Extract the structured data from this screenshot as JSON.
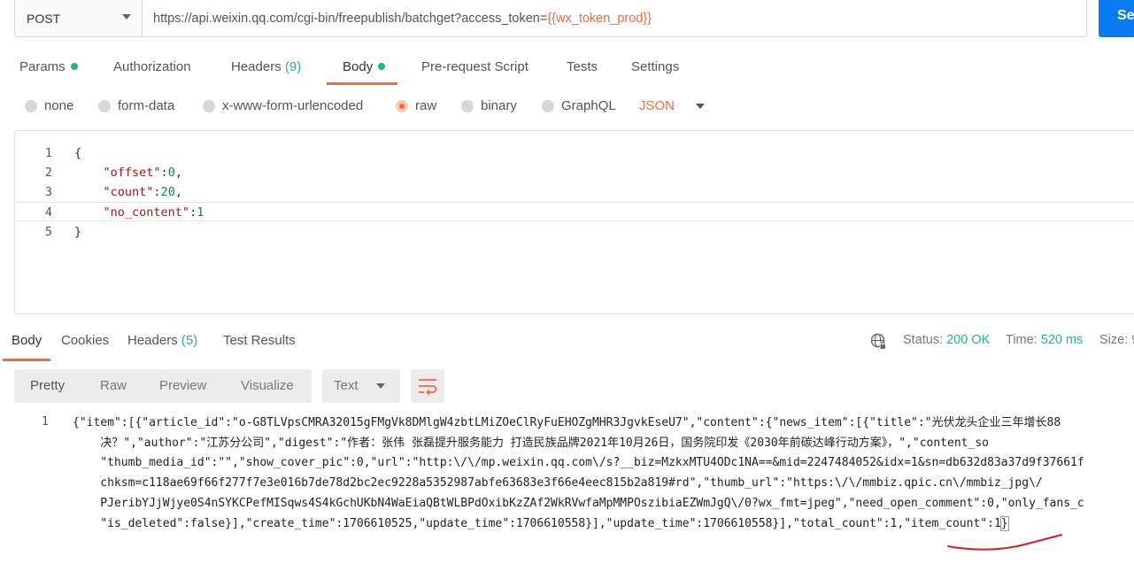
{
  "request": {
    "method": "POST",
    "url_prefix": "https://api.weixin.qq.com/cgi-bin/freepublish/batchget?access_token=",
    "url_variable": "{{wx_token_prod}}",
    "send_label": "Se"
  },
  "req_tabs": {
    "params": "Params",
    "authorization": "Authorization",
    "headers": "Headers",
    "headers_count": "(9)",
    "body": "Body",
    "prerequest": "Pre-request Script",
    "tests": "Tests",
    "settings": "Settings"
  },
  "body_types": {
    "none": "none",
    "form_data": "form-data",
    "urlencoded": "x-www-form-urlencoded",
    "raw": "raw",
    "binary": "binary",
    "graphql": "GraphQL",
    "format": "JSON"
  },
  "editor": {
    "lines": [
      {
        "num": "1",
        "open": "{"
      },
      {
        "num": "2",
        "key": "\"offset\"",
        "sep": ":",
        "value": "0",
        "tail": ","
      },
      {
        "num": "3",
        "key": "\"count\"",
        "sep": ":",
        "value": "20",
        "tail": ","
      },
      {
        "num": "4",
        "key": "\"no_content\"",
        "sep": ":",
        "value": "1",
        "tail": ""
      },
      {
        "num": "5",
        "close": "}"
      }
    ]
  },
  "resp_tabs": {
    "body": "Body",
    "cookies": "Cookies",
    "headers": "Headers",
    "headers_count": "(5)",
    "test_results": "Test Results"
  },
  "status": {
    "status_label": "Status:",
    "status_value": "200 OK",
    "time_label": "Time:",
    "time_value": "520 ms",
    "size_label": "Size:",
    "size_value": "9"
  },
  "view_modes": {
    "pretty": "Pretty",
    "raw": "Raw",
    "preview": "Preview",
    "visualize": "Visualize",
    "text_format": "Text"
  },
  "response": {
    "line_number": "1",
    "lines": [
      "{\"item\":[{\"article_id\":\"o-G8TLVpsCMRA32015gFMgVk8DMlgW4zbtLMiZOeClRyFuEHOZgMHR3JgvkEseU7\",\"content\":{\"news_item\":[{\"title\":\"光伏龙头企业三年增长88",
      "    决？\",\"author\":\"江苏分公司\",\"digest\":\"作者：张伟 张磊提升服务能力 打造民族品牌2021年10月26日，国务院印发《2030年前碳达峰行动方案》，\",\"content_so",
      "    \"thumb_media_id\":\"\",\"show_cover_pic\":0,\"url\":\"http:\\/\\/mp.weixin.qq.com\\/s?__biz=MzkxMTU4ODc1NA==&mid=2247484052&idx=1&sn=db632d83a37d9f37661f",
      "    chksm=c118ae69f66f277f7e3e016b7de78d2bc2ec9228a5352987abfe63683e3f66e4eec815b2a819#rd\",\"thumb_url\":\"https:\\/\\/mmbiz.qpic.cn\\/mmbiz_jpg\\/",
      "    PJeribYJjWjye0S4nSYKCPefMISqws4S4kGchUKbN4WaEiaQBtWLBPdOxibKzZAf2WkRVwfaMpMMPOszibiaEZWmJgQ\\/0?wx_fmt=jpeg\",\"need_open_comment\":0,\"only_fans_c",
      "    \"is_deleted\":false}],\"create_time\":1706610525,\"update_time\":1706610558}],\"update_time\":1706610558}],\"total_count\":1,\"item_count\":1"
    ],
    "last_bracket": "}"
  }
}
